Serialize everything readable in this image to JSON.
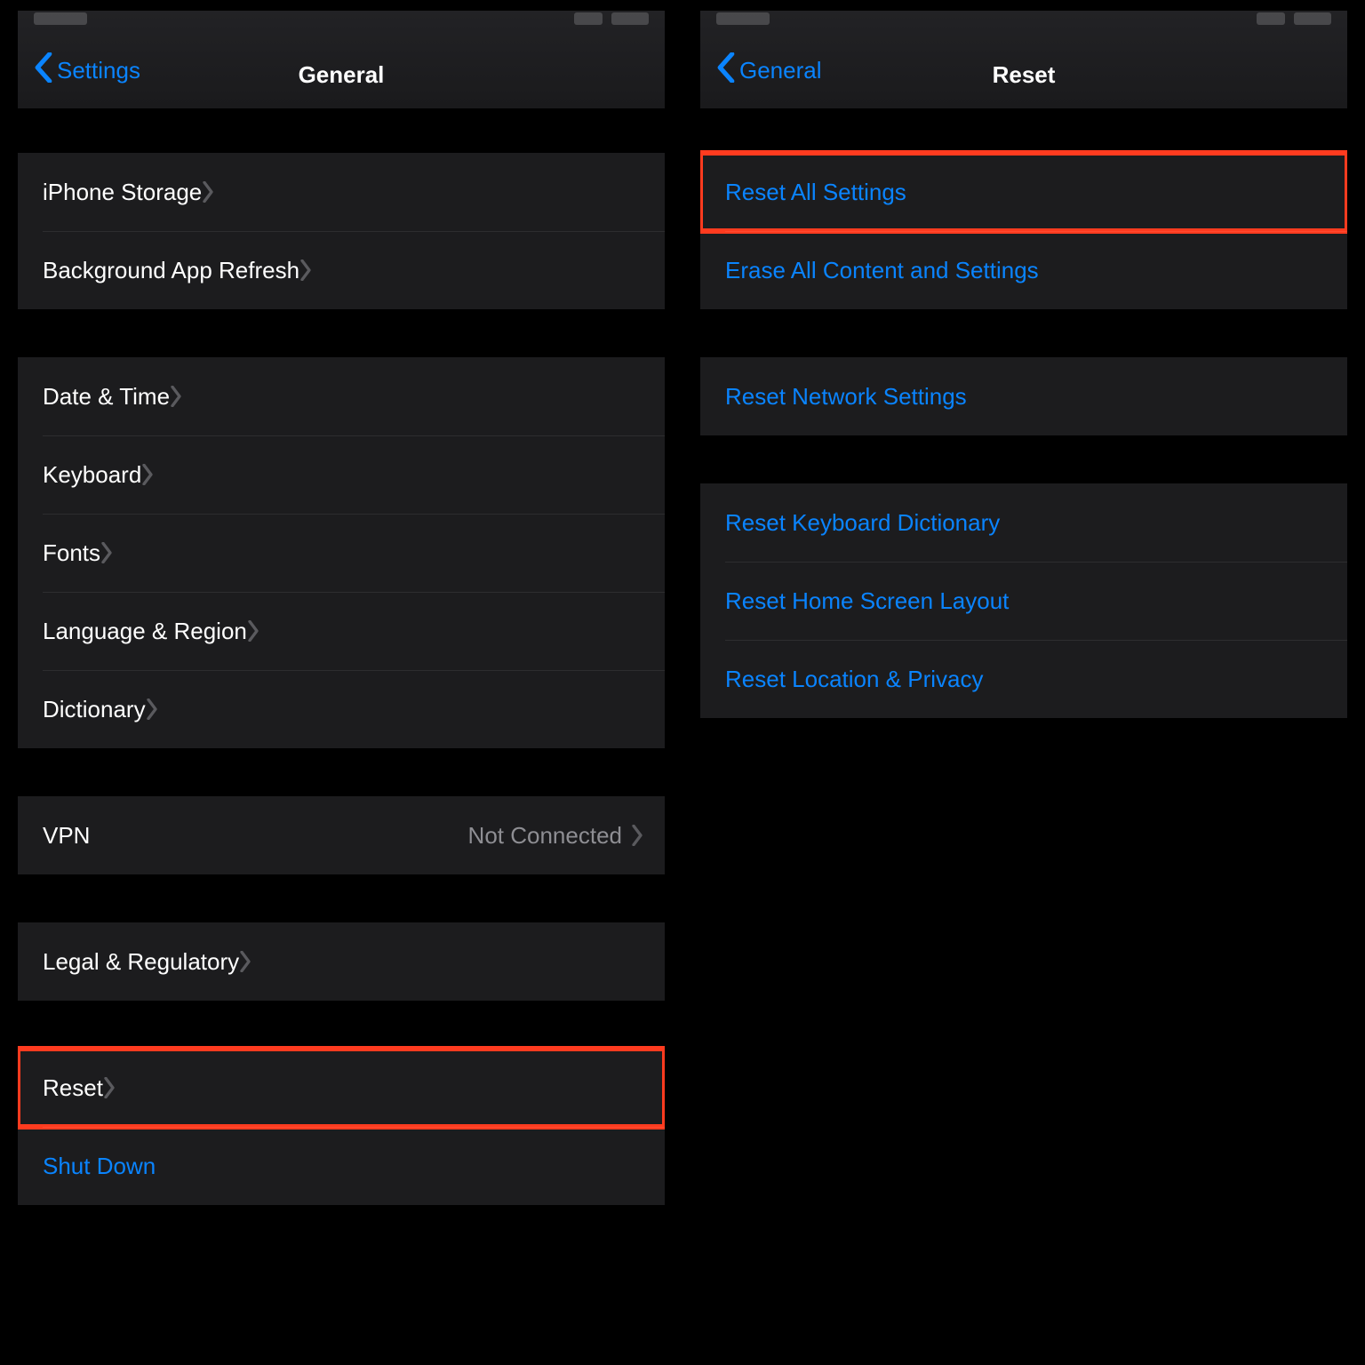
{
  "left": {
    "nav": {
      "back": "Settings",
      "title": "General"
    },
    "groups": [
      {
        "rows": [
          {
            "name": "row-iphone-storage",
            "label": "iPhone Storage"
          },
          {
            "name": "row-background-app-refresh",
            "label": "Background App Refresh"
          }
        ]
      },
      {
        "rows": [
          {
            "name": "row-date-time",
            "label": "Date & Time"
          },
          {
            "name": "row-keyboard",
            "label": "Keyboard"
          },
          {
            "name": "row-fonts",
            "label": "Fonts"
          },
          {
            "name": "row-language-region",
            "label": "Language & Region"
          },
          {
            "name": "row-dictionary",
            "label": "Dictionary"
          }
        ]
      },
      {
        "rows": [
          {
            "name": "row-vpn",
            "label": "VPN",
            "value": "Not Connected"
          }
        ]
      },
      {
        "rows": [
          {
            "name": "row-legal-regulatory",
            "label": "Legal & Regulatory"
          }
        ]
      },
      {
        "rows": [
          {
            "name": "row-reset",
            "label": "Reset",
            "highlight": true
          },
          {
            "name": "row-shut-down",
            "label": "Shut Down",
            "blue": true,
            "noarrow": true
          }
        ]
      }
    ]
  },
  "right": {
    "nav": {
      "back": "General",
      "title": "Reset"
    },
    "groups": [
      {
        "rows": [
          {
            "name": "row-reset-all-settings",
            "label": "Reset All Settings",
            "highlight": true
          },
          {
            "name": "row-erase-all",
            "label": "Erase All Content and Settings"
          }
        ]
      },
      {
        "rows": [
          {
            "name": "row-reset-network",
            "label": "Reset Network Settings"
          }
        ]
      },
      {
        "rows": [
          {
            "name": "row-reset-keyboard-dict",
            "label": "Reset Keyboard Dictionary"
          },
          {
            "name": "row-reset-home-layout",
            "label": "Reset Home Screen Layout"
          },
          {
            "name": "row-reset-location-privacy",
            "label": "Reset Location & Privacy"
          }
        ]
      }
    ]
  }
}
